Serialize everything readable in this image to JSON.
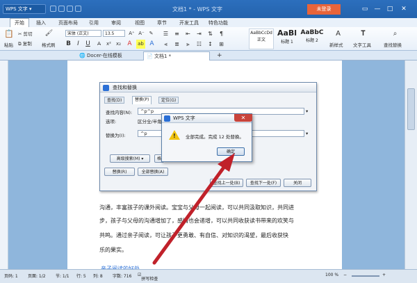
{
  "app": {
    "logo_label": "WPS 文字",
    "window_title": "文档1 * - WPS 文字",
    "login_button": "未登录",
    "controls": [
      "▭",
      "—",
      "□",
      "✕"
    ]
  },
  "menu_tabs": [
    "开始",
    "插入",
    "页面布局",
    "引用",
    "审阅",
    "视图",
    "章节",
    "开发工具",
    "特色功能"
  ],
  "ribbon": {
    "paste_label": "粘贴",
    "cut_label": "剪切",
    "copy_label": "复制",
    "format_painter_label": "格式刷",
    "font_name": "宋体 (正文)",
    "font_size": "13.5",
    "bold": "B",
    "italic": "I",
    "underline": "U",
    "styles": [
      {
        "preview": "AaBbCcDd",
        "name": "正文"
      },
      {
        "preview": "AaBl",
        "name": "标题 1"
      },
      {
        "preview": "AaBbC",
        "name": "标题 2"
      }
    ],
    "new_style_label": "新样式",
    "text_tools_label": "文字工具",
    "find_replace_label": "查找替换"
  },
  "doc_tabs": [
    {
      "label": "Docer-在线模板",
      "active": false
    },
    {
      "label": "文档1 *",
      "active": true
    }
  ],
  "dialog": {
    "title": "查找和替换",
    "tabs": [
      "查找(D)",
      "替换(P)",
      "定位(G)"
    ],
    "find_label": "查找内容(N):",
    "find_value": "^p^p",
    "options_label": "选项:",
    "options_value": "区分全/半角",
    "replace_label": "替换为(I):",
    "replace_value": "^p",
    "advanced_button": "高级搜索(M) ▾",
    "format_button": "格",
    "replace_button": "替换(R)",
    "replace_all_button": "全部替换(A)",
    "find_prev_button": "查找上一处(B)",
    "find_next_button": "查找下一处(F)",
    "close_button": "关闭"
  },
  "message_box": {
    "title": "WPS 文字",
    "text": "全部完成。完成 12 处替换。",
    "ok_button": "确定"
  },
  "document": {
    "lines": [
      "沟通，丰富孩子的课外阅读。宝宝与父母一起阅读，可以共同汲取知识，共同进",
      "步，孩子与父母的沟通增加了，感情也会递增，可以共同收获读书带来的欢笑与",
      "共鸣。通过亲子阅读，可让孩子更勇敢、有自信、对知识的渴望，最后收获快",
      "乐的果实。"
    ],
    "heading": "亲子阅读的好处"
  },
  "status_bar": {
    "page_num": "页码: 1",
    "pages": "页面: 1/2",
    "section": "节: 1/1",
    "row": "行: 5",
    "col": "列: 8",
    "words": "字数: 716",
    "spell_check": "拼写检查",
    "zoom": "100 %"
  },
  "colors": {
    "titlebar": "#2463ad",
    "login": "#e8643a",
    "close_red": "#c9433a",
    "arrow": "#c0212a",
    "link_blue": "#2a6fd6"
  }
}
